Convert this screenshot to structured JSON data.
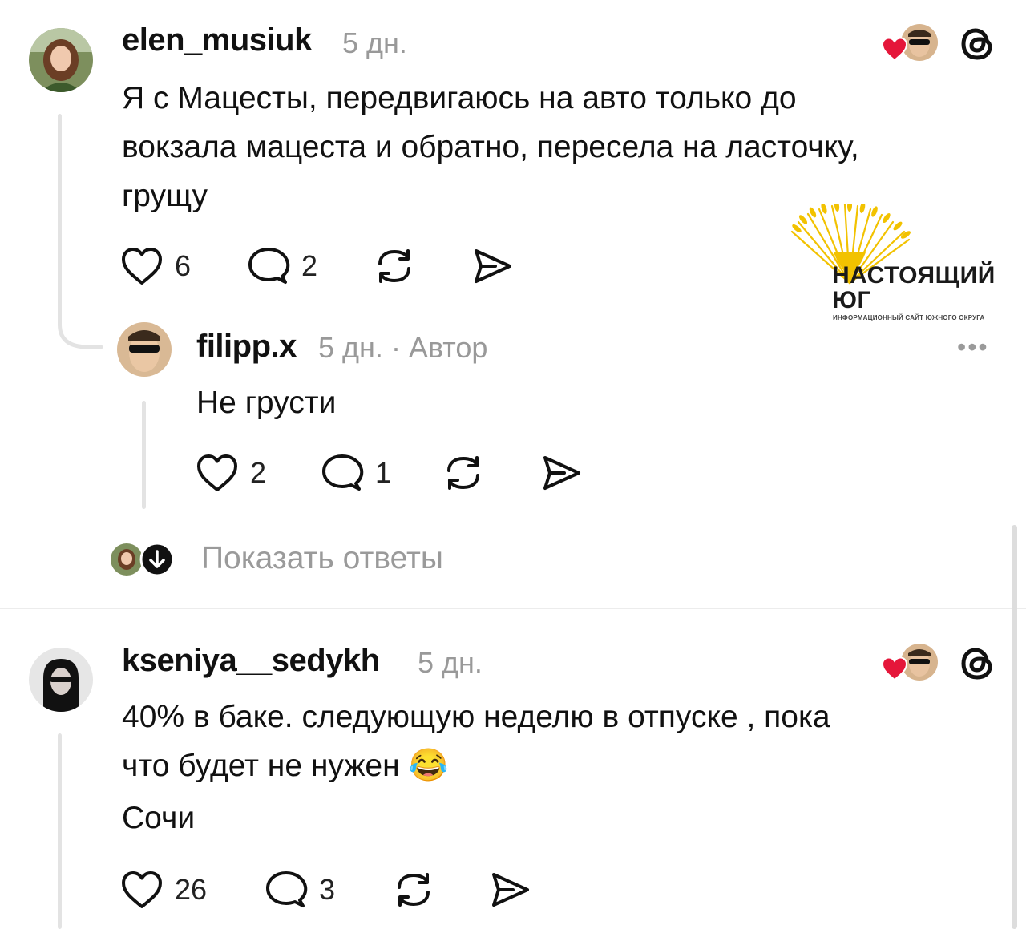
{
  "comments": [
    {
      "username": "elen_musiuk",
      "time": "5 дн.",
      "text_lines": [
        "Я с Мацесты, передвигаюсь на авто только до",
        "вокзала мацеста и обратно, пересела на ласточку,",
        "грущу"
      ],
      "likes": "6",
      "replies": "2"
    },
    {
      "username": "filipp.x",
      "time": "5 дн.",
      "author_tag": "· Автор",
      "text_lines": [
        "Не грусти"
      ],
      "likes": "2",
      "replies": "1"
    },
    {
      "username": "kseniya__sedykh",
      "time": "5 дн.",
      "text_lines": [
        "40% в баке. следующую неделю в отпуске , пока",
        "что будет не нужен",
        "Сочи"
      ],
      "emoji": "😂",
      "likes": "26",
      "replies": "3"
    }
  ],
  "show_replies": "Показать ответы",
  "watermark": {
    "title_line1": "НАСТОЯЩИЙ",
    "title_line2": "ЮГ",
    "subtitle": "ИНФОРМАЦИОННЫЙ САЙТ ЮЖНОГО ОКРУГА"
  },
  "more_menu": "•••",
  "icons": {
    "like": "heart-outline-icon",
    "reply": "comment-bubble-icon",
    "repost": "repost-icon",
    "share": "send-icon",
    "threads": "threads-logo-icon",
    "author_liked": "heart-filled-icon"
  },
  "colors": {
    "heart_red": "#e5163a",
    "muted": "#999999",
    "wheat": "#f2c200"
  }
}
